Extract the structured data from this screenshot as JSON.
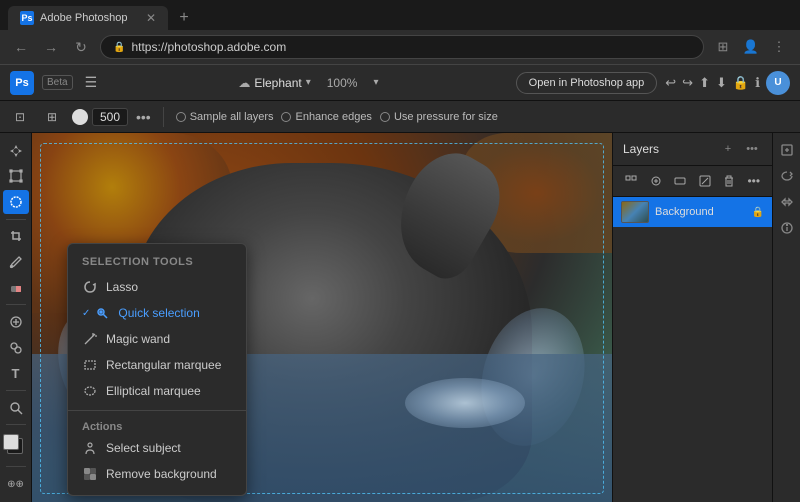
{
  "browser": {
    "tab": {
      "title": "Adobe Photoshop",
      "url": "https://photoshop.adobe.com"
    },
    "new_tab_icon": "+"
  },
  "app_header": {
    "logo": "Ps",
    "beta_label": "Beta",
    "file_name": "Elephant",
    "zoom": "100%",
    "open_btn_label": "Open in Photoshop app",
    "undo_icon": "↩",
    "redo_icon": "↪"
  },
  "toolbar": {
    "brush_size": "500",
    "options": [
      "Sample all layers",
      "Enhance edges",
      "Use pressure for size"
    ]
  },
  "selection_popup": {
    "header": "Selection tools",
    "tools": [
      {
        "label": "Lasso",
        "icon": "⌒"
      },
      {
        "label": "Quick selection",
        "icon": "✦",
        "active": true
      },
      {
        "label": "Magic wand",
        "icon": "✦"
      },
      {
        "label": "Rectangular marquee",
        "icon": "▭"
      },
      {
        "label": "Elliptical marquee",
        "icon": "◯"
      }
    ],
    "actions_header": "Actions",
    "actions": [
      {
        "label": "Select subject",
        "icon": "👤"
      },
      {
        "label": "Remove background",
        "icon": "🖼"
      }
    ]
  },
  "layers_panel": {
    "title": "Layers",
    "layer": {
      "name": "Background"
    }
  },
  "left_tools": [
    "↖",
    "↗",
    "⊡",
    "✂",
    "🖊",
    "✏",
    "⌂",
    "⊹",
    "T",
    "⌀"
  ],
  "colors": {
    "active": "#1473e6",
    "panel_bg": "#2b2b2b",
    "canvas_bg": "#3a3a3a",
    "text_primary": "#ddd",
    "text_secondary": "#aaa"
  }
}
